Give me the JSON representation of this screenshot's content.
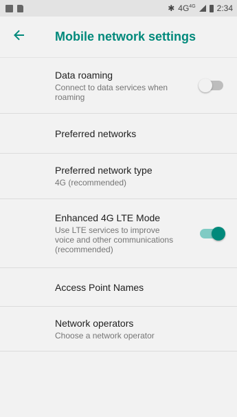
{
  "status_bar": {
    "network": "4G",
    "network_sup": "4G",
    "time": "2:34"
  },
  "header": {
    "title": "Mobile network settings",
    "back_icon": "arrow-left-icon"
  },
  "colors": {
    "accent": "#00897b",
    "accent_light": "#80cbc4"
  },
  "settings": [
    {
      "title": "Data roaming",
      "subtitle": "Connect to data services when roaming",
      "toggle": "off"
    },
    {
      "title": "Preferred networks",
      "subtitle": ""
    },
    {
      "title": "Preferred network type",
      "subtitle": "4G (recommended)"
    },
    {
      "title": "Enhanced 4G LTE Mode",
      "subtitle": "Use LTE services to improve voice and other communications (recommended)",
      "toggle": "on"
    },
    {
      "title": "Access Point Names",
      "subtitle": ""
    },
    {
      "title": "Network operators",
      "subtitle": "Choose a network operator"
    }
  ]
}
